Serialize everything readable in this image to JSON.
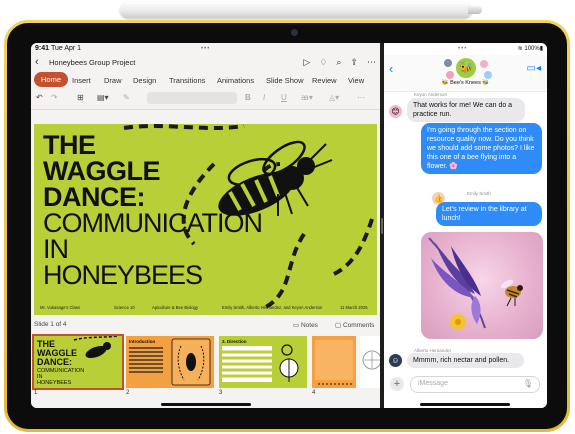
{
  "left_app": {
    "status_time": "9:41",
    "status_date": "Tue Apr 1",
    "doc_title": "Honeybees Group Project",
    "tabs": [
      {
        "label": "Home",
        "active": true
      },
      {
        "label": "Insert"
      },
      {
        "label": "Draw"
      },
      {
        "label": "Design"
      },
      {
        "label": "Transitions"
      },
      {
        "label": "Animations"
      },
      {
        "label": "Slide Show"
      },
      {
        "label": "Review"
      },
      {
        "label": "View"
      }
    ],
    "toolbar": {
      "bold": "B",
      "italic": "I",
      "underline": "U"
    },
    "slide": {
      "title_lines": [
        "THE",
        "WAGGLE",
        "DANCE:"
      ],
      "subtitle_lines": [
        "COMMUNICATION",
        "IN",
        "HONEYBEES"
      ],
      "footer": {
        "class_name": "Mr. Vukasage's Class",
        "science": "Science 10",
        "course": "Apiculture & Bee Biology",
        "authors": "Emily Smith, Alberto Hernandez, and Keyon Anderson",
        "date": "11 March 2025"
      }
    },
    "slide_counter": "Slide 1 of 4",
    "notes_label": "Notes",
    "comments_label": "Comments",
    "thumbnails": [
      {
        "number": "1",
        "title_lines": [
          "THE",
          "WAGGLE",
          "DANCE:"
        ],
        "subtitle_lines": [
          "COMMUNICATION",
          "IN",
          "HONEYBEES"
        ]
      },
      {
        "number": "2",
        "caption": "Introduction"
      },
      {
        "number": "3",
        "caption": "3. Direction"
      },
      {
        "number": "4"
      }
    ]
  },
  "messages": {
    "group_name": "🐝 Bee's Knees 🐝",
    "thread": [
      {
        "sender": "Keyon Anderson",
        "text": "That works for me! We can do a practice run.",
        "direction": "in"
      },
      {
        "text": "I'm going through the section on resource quality now. Do you think we should add some photos? I like this one of a bee flying into a flower. 🌸",
        "direction": "out"
      },
      {
        "sender": "Emily Smith",
        "text": "Let's review in the library at lunch!",
        "direction": "out"
      },
      {
        "sender": "Alberto Hernandez",
        "text": "Mmmm, rich nectar and pollen.",
        "direction": "in"
      }
    ],
    "input_placeholder": "iMessage"
  },
  "colors": {
    "device_frame": "#e9c24a",
    "ribbon_accent": "#c3502e",
    "slide_green": "#b8cf37",
    "slide_orange": "#f2a041",
    "imessage_blue": "#2f8cf7",
    "incoming_gray": "#e9e9eb"
  },
  "icons": [
    "apple-pencil",
    "back-chevron-icon",
    "play-icon",
    "lightbulb-icon",
    "search-icon",
    "share-icon",
    "more-icon",
    "undo-icon",
    "redo-icon",
    "video-call-icon",
    "plus-icon",
    "mic-icon"
  ]
}
